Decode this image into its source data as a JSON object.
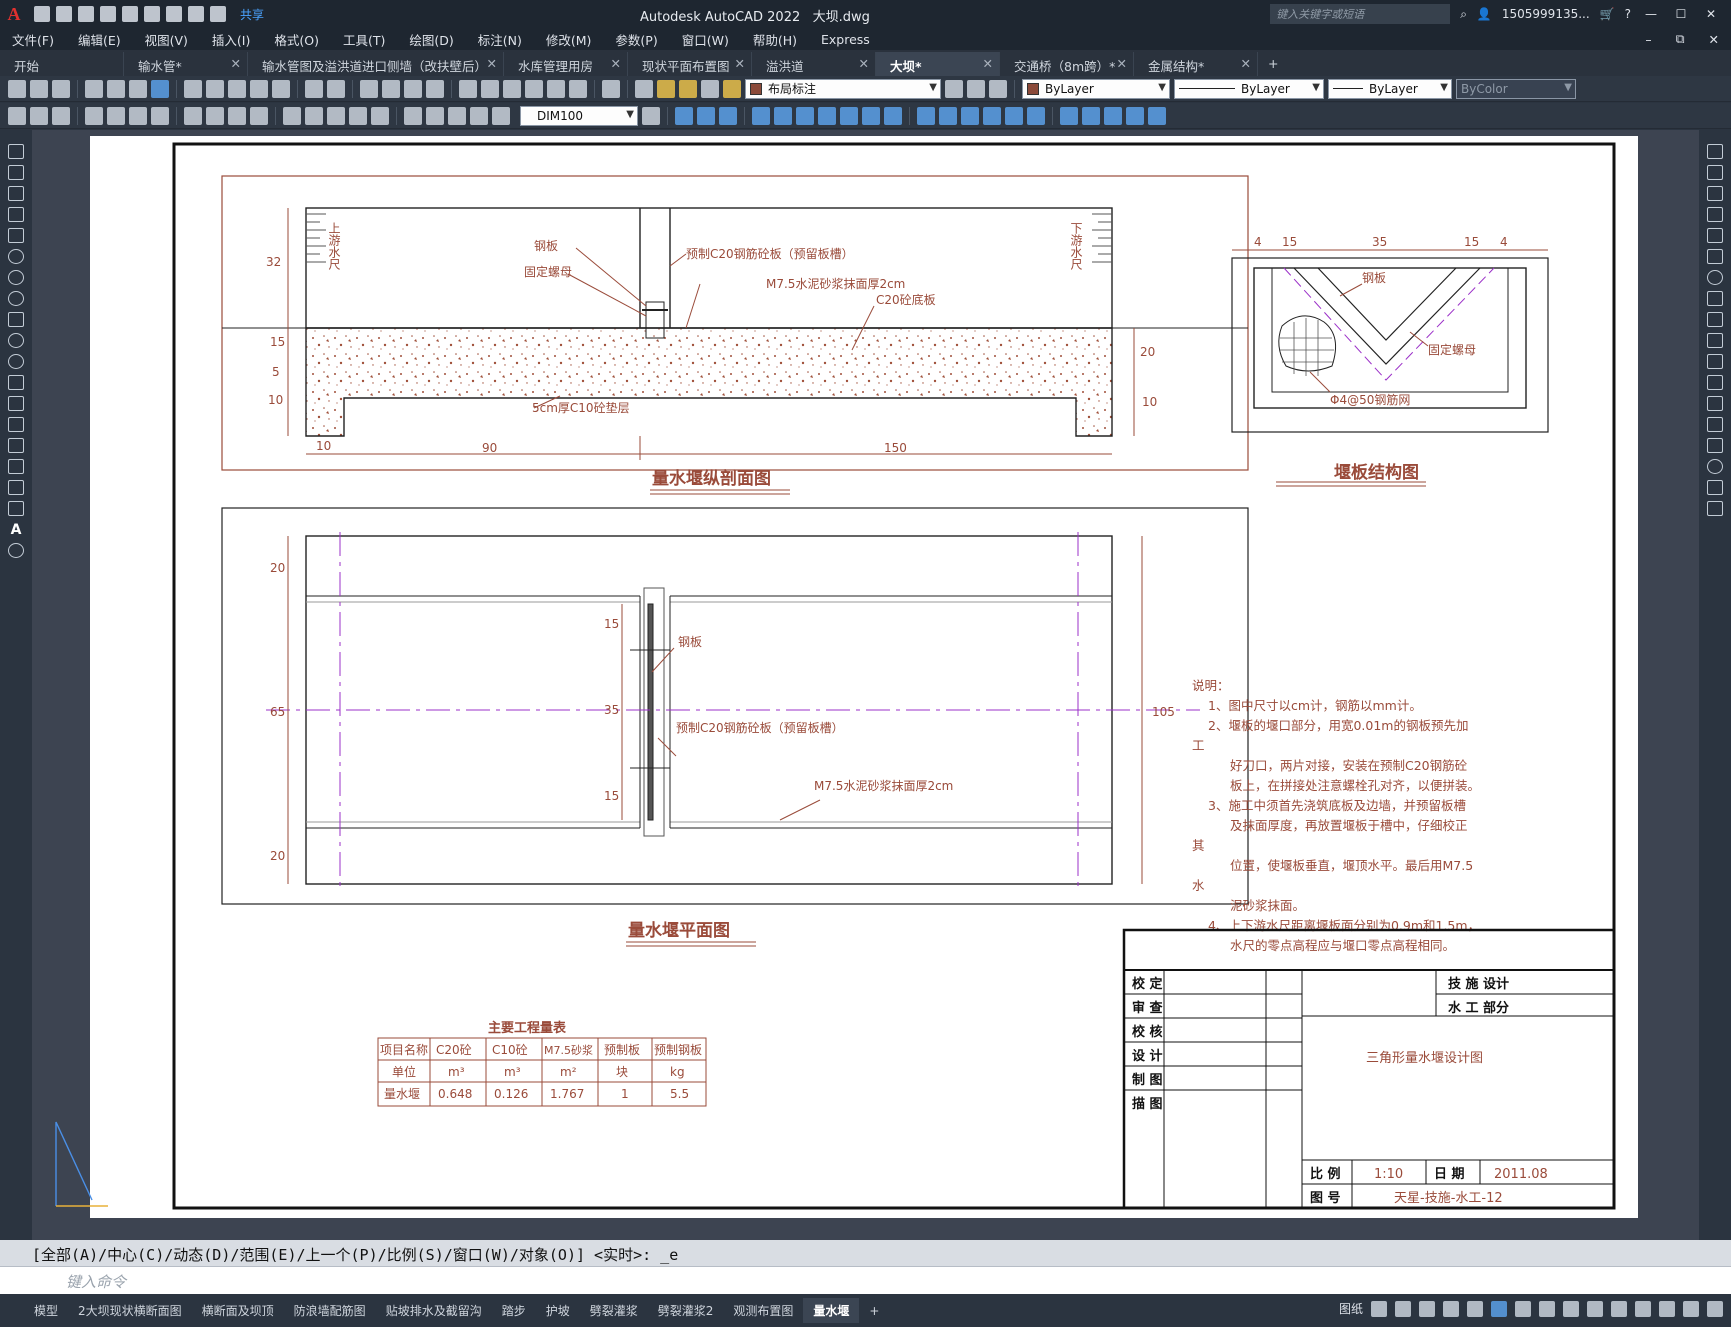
{
  "app": {
    "title": "Autodesk AutoCAD 2022",
    "document": "大坝.dwg",
    "search_placeholder": "键入关键字或短语",
    "user": "1505999135...",
    "share": "共享"
  },
  "menu": [
    "文件(F)",
    "编辑(E)",
    "视图(V)",
    "插入(I)",
    "格式(O)",
    "工具(T)",
    "绘图(D)",
    "标注(N)",
    "修改(M)",
    "参数(P)",
    "窗口(W)",
    "帮助(H)",
    "Express"
  ],
  "doc_tabs": [
    {
      "label": "开始",
      "active": false,
      "closable": false
    },
    {
      "label": "输水管*",
      "active": false,
      "closable": true
    },
    {
      "label": "输水管图及溢洪道进口侧墙（改扶壁后）",
      "active": false,
      "closable": true
    },
    {
      "label": "水库管理用房",
      "active": false,
      "closable": true
    },
    {
      "label": "现状平面布置图",
      "active": false,
      "closable": true
    },
    {
      "label": "溢洪道",
      "active": false,
      "closable": true
    },
    {
      "label": "大坝*",
      "active": true,
      "closable": true
    },
    {
      "label": "交通桥（8m跨）*",
      "active": false,
      "closable": true
    },
    {
      "label": "金属结构*",
      "active": false,
      "closable": true
    }
  ],
  "toolbar": {
    "layer": "布局标注",
    "color": "ByLayer",
    "linetype": "ByLayer",
    "lineweight": "ByLayer",
    "plotstyle": "ByColor",
    "dimstyle": "DIM100"
  },
  "drawing": {
    "section_title": "量水堰纵剖面图",
    "plan_title": "量水堰平面图",
    "weir_title": "堰板结构图",
    "labels": {
      "upstream_gauge": "上游水尺",
      "downstream_gauge": "下游水尺",
      "steel_plate": "钢板",
      "fixing_nut": "固定螺母",
      "precast_slab": "预制C20钢筋砼板（预留板槽）",
      "mortar": "M7.5水泥砂浆抹面厚2cm",
      "base_slab": "C20砼底板",
      "cushion": "5cm厚C10砼垫层",
      "mesh": "Φ4@50钢筋网"
    },
    "dims_section": {
      "d32": "32",
      "d15": "15",
      "d5": "5",
      "d10a": "10",
      "d20": "20",
      "d10b": "10",
      "w10": "10",
      "w90": "90",
      "w150": "150"
    },
    "dims_plan": {
      "d20a": "20",
      "d65": "65",
      "d20b": "20",
      "d15a": "15",
      "d35": "35",
      "d15b": "15",
      "d105": "105"
    },
    "dims_weir": {
      "a": "4",
      "b": "15",
      "c": "35",
      "d": "15",
      "e": "4"
    },
    "notes": {
      "heading": "说明：",
      "lines": [
        "1、图中尺寸以cm计，钢筋以mm计。",
        "2、堰板的堰口部分，用宽0.01m的钢板预先加",
        "工",
        "好刀口，两片对接，安装在预制C20钢筋砼",
        "板上，在拼接处注意螺栓孔对齐，以便拼装。",
        "3、施工中须首先浇筑底板及边墙，并预留板槽",
        "及抹面厚度，再放置堰板于槽中，仔细校正",
        "其",
        "位置，使堰板垂直，堰顶水平。最后用M7.5",
        "水",
        "泥砂浆抹面。",
        "4、上下游水尺距离堰板面分别为0.9m和1.5m，",
        "水尺的零点高程应与堰口零点高程相同。"
      ]
    },
    "quantity_table": {
      "title": "主要工程量表",
      "headers": [
        "项目名称",
        "C20砼",
        "C10砼",
        "M7.5砂浆",
        "预制板",
        "预制钢板"
      ],
      "units": [
        "单位",
        "m³",
        "m³",
        "m²",
        "块",
        "kg"
      ],
      "row": [
        "量水堰",
        "0.648",
        "0.126",
        "1.767",
        "1",
        "5.5"
      ]
    },
    "title_block": {
      "roles": [
        "校 定",
        "审 查",
        "校 核",
        "设 计",
        "制 图",
        "描 图"
      ],
      "org1": "技 施 设计",
      "org2": "水 工 部分",
      "drawing_name": "三角形量水堰设计图",
      "scale_label": "比 例",
      "scale": "1:10",
      "date_label": "日 期",
      "date": "2011.08",
      "no_label": "图 号",
      "no": "天星-技施-水工-12"
    }
  },
  "command": {
    "history": "[全部(A)/中心(C)/动态(D)/范围(E)/上一个(P)/比例(S)/窗口(W)/对象(O)] <实时>: _e",
    "placeholder": "键入命令"
  },
  "layout_tabs": [
    {
      "label": "模型",
      "active": false
    },
    {
      "label": "2大坝现状横断面图",
      "active": false
    },
    {
      "label": "横断面及坝顶",
      "active": false
    },
    {
      "label": "防浪墙配筋图",
      "active": false
    },
    {
      "label": "贴坡排水及截留沟",
      "active": false
    },
    {
      "label": "踏步",
      "active": false
    },
    {
      "label": "护坡",
      "active": false
    },
    {
      "label": "劈裂灌浆",
      "active": false
    },
    {
      "label": "劈裂灌浆2",
      "active": false
    },
    {
      "label": "观测布置图",
      "active": false
    },
    {
      "label": "量水堰",
      "active": true
    },
    {
      "label": "+",
      "active": false
    }
  ],
  "status": {
    "paper": "图纸"
  },
  "colors": {
    "line": "#9a4b3a",
    "dash": "#9b30c8",
    "frame": "#111111"
  }
}
